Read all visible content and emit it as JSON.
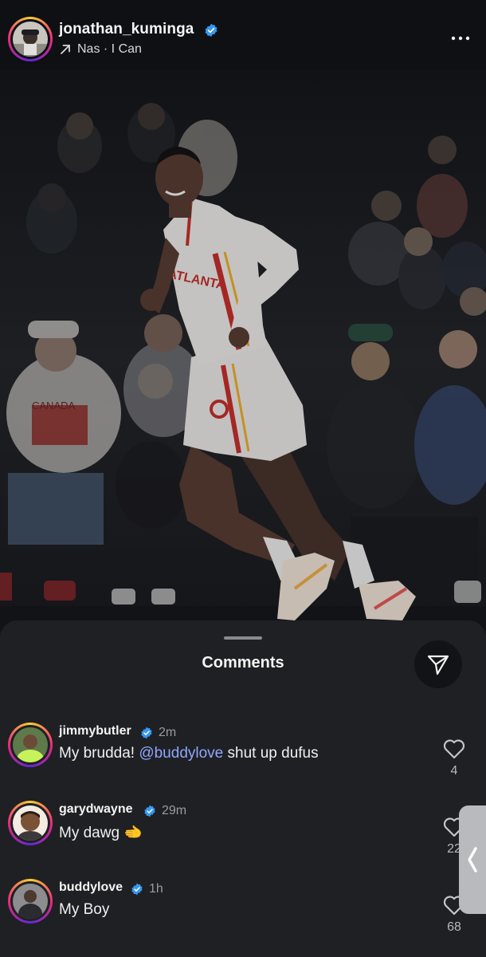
{
  "post": {
    "username": "jonathan_kuminga",
    "audio_arrow_icon": "arrow-up-right-icon",
    "audio_label": "Nas · I Can",
    "more_icon": "more-horizontal-icon"
  },
  "photo": {
    "description_icon": "post-photo",
    "shirt_text": "CANADA",
    "jersey_text": "ATLANTA"
  },
  "comments_sheet": {
    "title": "Comments",
    "share_icon": "paper-plane-icon",
    "comments": [
      {
        "username": "jimmybutler",
        "time": "2m",
        "text_before": "My brudda! ",
        "mention": "@buddylove",
        "text_after": " shut up dufus",
        "likes": "4"
      },
      {
        "username": "garydwayne",
        "time": "29m",
        "text_before": "My dawg ",
        "emoji": "🫲",
        "likes": "22"
      },
      {
        "username": "buddylove",
        "time": "1h",
        "text_before": "My Boy",
        "likes": "68"
      }
    ]
  },
  "edge_tab": {
    "icon": "chevron-left-icon"
  },
  "colors": {
    "background": "#0e1014",
    "sheet": "#1f2023",
    "verified": "#3797f0",
    "mention": "#8fa7ff",
    "ring_gradient": [
      "#f9ce34",
      "#ee2a7b",
      "#6228d7"
    ]
  }
}
